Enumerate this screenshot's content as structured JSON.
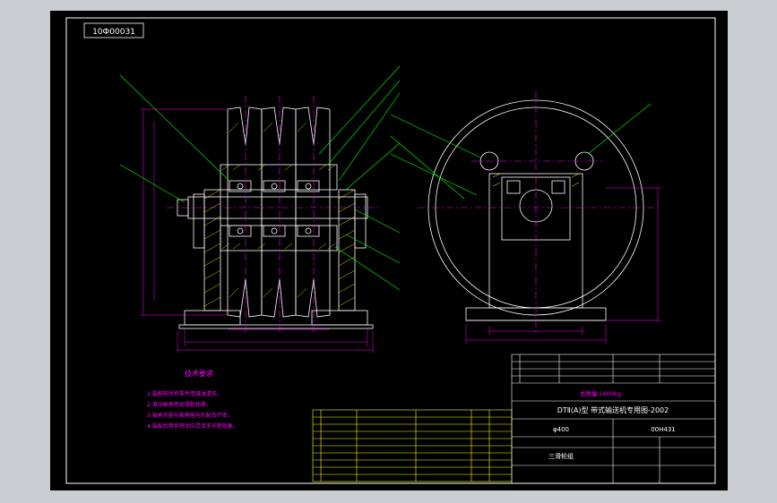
{
  "drawing": {
    "code_box": "10Ф00031",
    "tech_requirements_title": "技术要求",
    "tech_requirements": [
      "1.装配前所有零件用煤油清洗，",
      "2.滚动轴承用润滑脂润滑，",
      "3.轴承外圈与轴承座内孔配合严密，",
      "4.装配后用手转动应灵活无卡阻现象。"
    ],
    "title_block": {
      "project_line": "DTⅡ(A)型 带式输送机专用图-2002",
      "row_info": "φ400",
      "drawing_no": "00H431",
      "part_name": "三滑轮组",
      "note_line": "总质量 1600kg"
    },
    "colors": {
      "drawing_line": "#ffffff",
      "frame": "#ffffff",
      "leader": "#00ff00",
      "dimension": "#ff00ff",
      "table_line": "#ffff00",
      "hatch": "#ffff00",
      "center_line": "#ff00ff"
    }
  }
}
